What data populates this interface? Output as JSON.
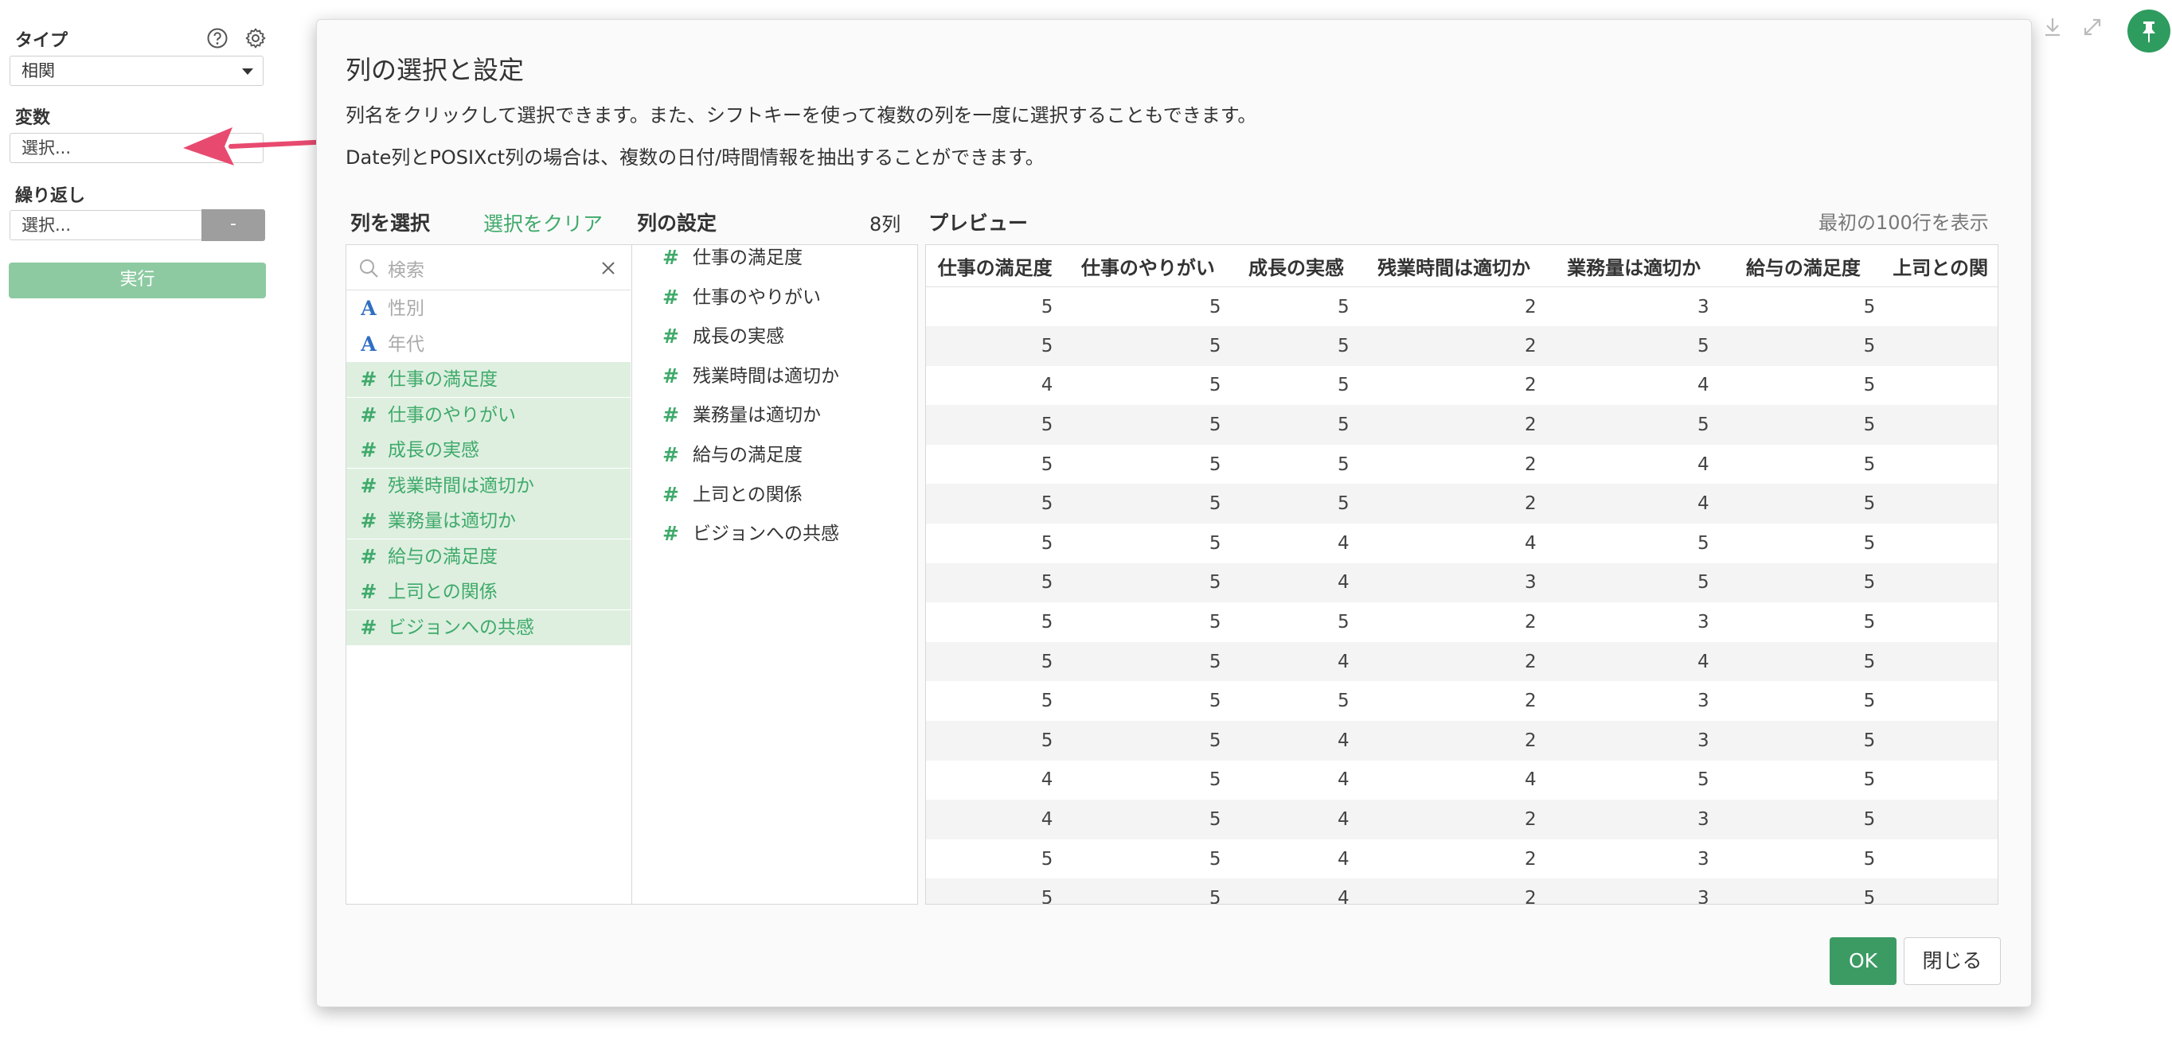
{
  "sidebar": {
    "type_label": "タイプ",
    "type_value": "相関",
    "variable_label": "変数",
    "variable_placeholder": "選択...",
    "repeat_label": "繰り返し",
    "repeat_placeholder": "選択...",
    "repeat_minus": "-",
    "run_label": "実行",
    "help_icon": "question-circle-icon",
    "settings_icon": "gear-icon"
  },
  "colors": {
    "accent_green": "#3faa6a",
    "selected_bg": "#deefe0",
    "ok_button": "#3b9b63",
    "run_button": "#8dcaa2",
    "annotation_arrow": "#e84a6f"
  },
  "modal": {
    "title": "列の選択と設定",
    "desc1": "列名をクリックして選択できます。また、シフトキーを使って複数の列を一度に選択することもできます。",
    "desc2": "Date列とPOSIXct列の場合は、複数の日付/時間情報を抽出することができます。",
    "select_header": "列を選択",
    "clear_link": "選択をクリア",
    "settings_header": "列の設定",
    "settings_count": "8列",
    "preview_header": "プレビュー",
    "preview_note": "最初の100行を表示",
    "search_placeholder": "検索",
    "columns": [
      {
        "icon": "A",
        "label": "性別",
        "selected": false
      },
      {
        "icon": "A",
        "label": "年代",
        "selected": false
      },
      {
        "icon": "#",
        "label": "仕事の満足度",
        "selected": true
      },
      {
        "icon": "#",
        "label": "仕事のやりがい",
        "selected": true
      },
      {
        "icon": "#",
        "label": "成長の実感",
        "selected": true
      },
      {
        "icon": "#",
        "label": "残業時間は適切か",
        "selected": true
      },
      {
        "icon": "#",
        "label": "業務量は適切か",
        "selected": true
      },
      {
        "icon": "#",
        "label": "給与の満足度",
        "selected": true
      },
      {
        "icon": "#",
        "label": "上司との関係",
        "selected": true
      },
      {
        "icon": "#",
        "label": "ビジョンへの共感",
        "selected": true
      }
    ],
    "settings": [
      {
        "icon": "#",
        "label": "仕事の満足度"
      },
      {
        "icon": "#",
        "label": "仕事のやりがい"
      },
      {
        "icon": "#",
        "label": "成長の実感"
      },
      {
        "icon": "#",
        "label": "残業時間は適切か"
      },
      {
        "icon": "#",
        "label": "業務量は適切か"
      },
      {
        "icon": "#",
        "label": "給与の満足度"
      },
      {
        "icon": "#",
        "label": "上司との関係"
      },
      {
        "icon": "#",
        "label": "ビジョンへの共感"
      }
    ],
    "preview": {
      "headers": [
        "仕事の満足度",
        "仕事のやりがい",
        "成長の実感",
        "残業時間は適切か",
        "業務量は適切か",
        "給与の満足度",
        "上司との関"
      ],
      "rows": [
        [
          "5",
          "5",
          "5",
          "2",
          "3",
          "5",
          ""
        ],
        [
          "5",
          "5",
          "5",
          "2",
          "5",
          "5",
          ""
        ],
        [
          "4",
          "5",
          "5",
          "2",
          "4",
          "5",
          ""
        ],
        [
          "5",
          "5",
          "5",
          "2",
          "5",
          "5",
          ""
        ],
        [
          "5",
          "5",
          "5",
          "2",
          "4",
          "5",
          ""
        ],
        [
          "5",
          "5",
          "5",
          "2",
          "4",
          "5",
          ""
        ],
        [
          "5",
          "5",
          "4",
          "4",
          "5",
          "5",
          ""
        ],
        [
          "5",
          "5",
          "4",
          "3",
          "5",
          "5",
          ""
        ],
        [
          "5",
          "5",
          "5",
          "2",
          "3",
          "5",
          ""
        ],
        [
          "5",
          "5",
          "4",
          "2",
          "4",
          "5",
          ""
        ],
        [
          "5",
          "5",
          "5",
          "2",
          "3",
          "5",
          ""
        ],
        [
          "5",
          "5",
          "4",
          "2",
          "3",
          "5",
          ""
        ],
        [
          "4",
          "5",
          "4",
          "4",
          "5",
          "5",
          ""
        ],
        [
          "4",
          "5",
          "4",
          "2",
          "3",
          "5",
          ""
        ],
        [
          "5",
          "5",
          "4",
          "2",
          "3",
          "5",
          ""
        ],
        [
          "5",
          "5",
          "4",
          "2",
          "3",
          "5",
          ""
        ]
      ]
    },
    "ok_label": "OK",
    "close_label": "閉じる"
  },
  "topbar": {
    "download_icon": "download-icon",
    "expand_icon": "expand-icon",
    "pin_icon": "pin-icon"
  }
}
